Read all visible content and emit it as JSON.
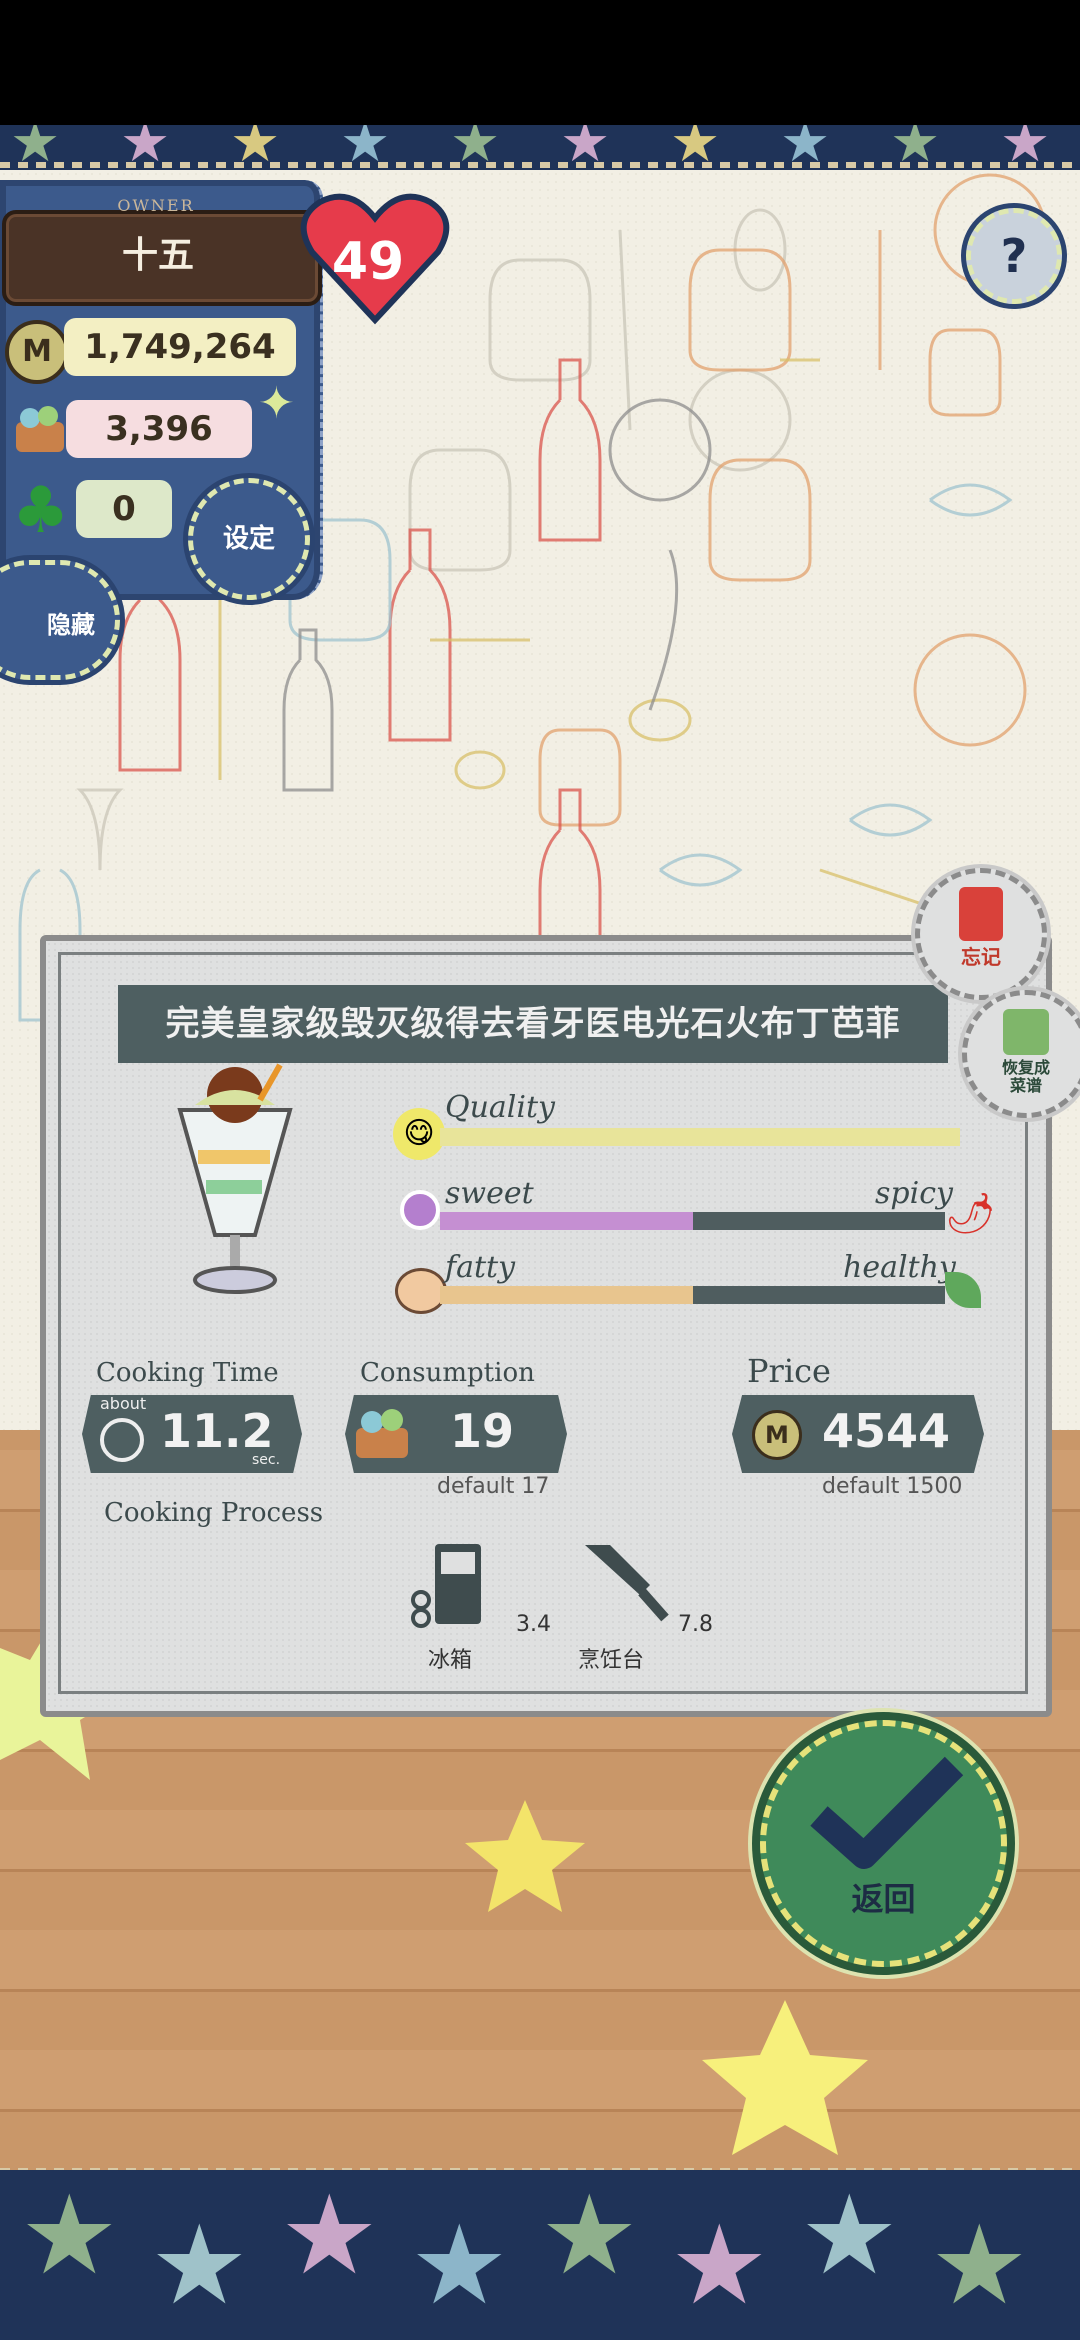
{
  "owner": {
    "label": "OWNER",
    "name": "十五",
    "coins": "1,749,264",
    "ingredients": "3,396",
    "clovers": "0",
    "hearts": "49"
  },
  "buttons": {
    "settings": "设定",
    "hide": "隐藏",
    "help": "?",
    "forget": "忘记",
    "restore": "恢复成\n菜谱",
    "back": "返回"
  },
  "recipe": {
    "name": "完美皇家级毁灭级得去看牙医电光石火布丁芭菲",
    "quality_label": "Quality",
    "quality_level": 1.0,
    "sweet_label": "sweet",
    "spicy_label": "spicy",
    "sweet_level": 0.5,
    "fatty_label": "fatty",
    "healthy_label": "healthy",
    "fatty_level": 0.5,
    "cooking_time_label": "Cooking Time",
    "about_label": "about",
    "cooking_time": "11.2",
    "sec_label": "sec.",
    "consumption_label": "Consumption",
    "consumption": "19",
    "consumption_default": "default 17",
    "price_label": "Price",
    "price": "4544",
    "price_default": "default 1500",
    "process_label": "Cooking Process",
    "process": [
      {
        "name": "冰箱",
        "time": "3.4",
        "icon": "fridge-icon"
      },
      {
        "name": "烹饪台",
        "time": "7.8",
        "icon": "knife-icon"
      }
    ]
  },
  "colors": {
    "panel_blue": "#3c5a8c",
    "card_gray": "#dfe0e0",
    "bar_dark": "#4e5f61",
    "quality_fill": "#e8e49a",
    "sweet_fill": "#c58fd2",
    "fatty_fill": "#e8c58e",
    "heart": "#e63b4b"
  }
}
